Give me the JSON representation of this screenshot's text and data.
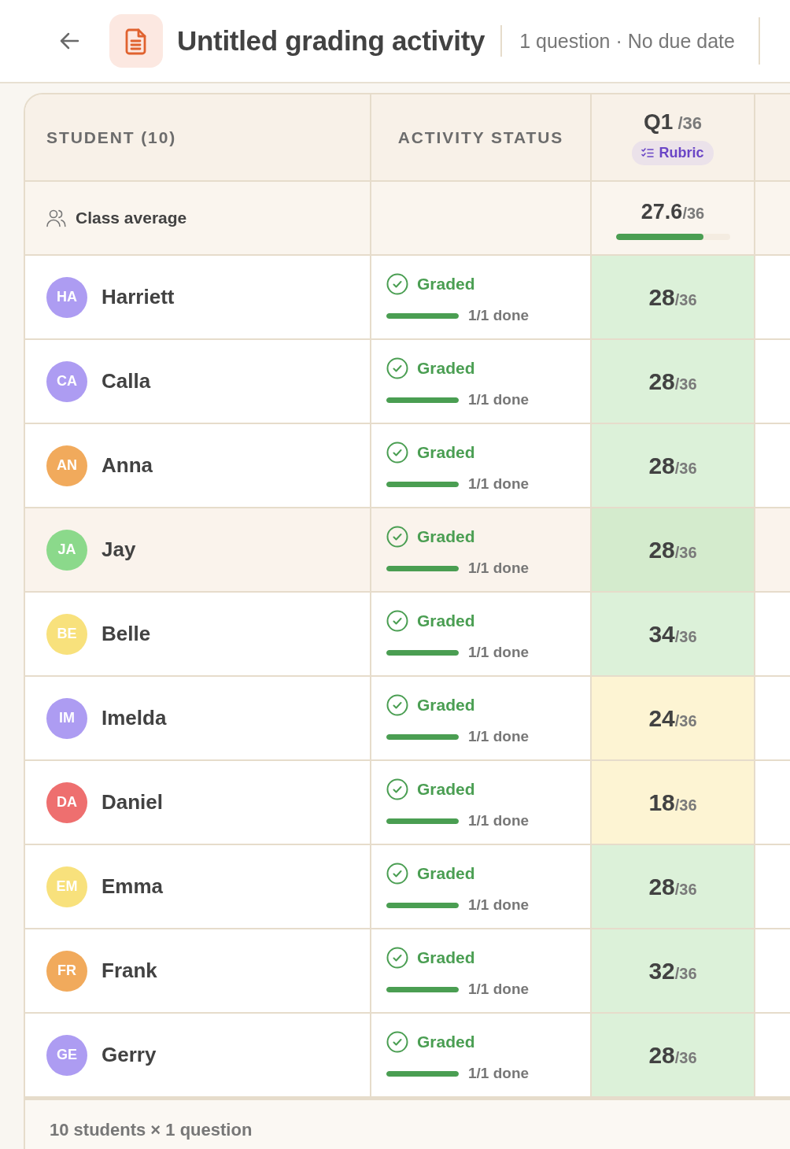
{
  "header": {
    "title": "Untitled grading activity",
    "subtitle": "1 question · No due date"
  },
  "table": {
    "columns": [
      {
        "kind": "text",
        "label": "STUDENT (10)"
      },
      {
        "kind": "text",
        "label": "ACTIVITY STATUS"
      },
      {
        "kind": "question",
        "label": "Q1",
        "max": "/36",
        "tag": "Rubric"
      }
    ],
    "class_average": {
      "label": "Class average",
      "score": "27.6",
      "max": "/36",
      "level": 0.767
    },
    "rows": [
      {
        "initials": "HA",
        "color": "#ad9cf2",
        "name": "Harriett",
        "selected": false,
        "status": "Graded",
        "progress": {
          "level": 1,
          "text": "1/1 done"
        },
        "score": {
          "value": "28",
          "max": "/36",
          "kind": "high"
        }
      },
      {
        "initials": "CA",
        "color": "#ad9cf2",
        "name": "Calla",
        "selected": false,
        "status": "Graded",
        "progress": {
          "level": 1,
          "text": "1/1 done"
        },
        "score": {
          "value": "28",
          "max": "/36",
          "kind": "high"
        }
      },
      {
        "initials": "AN",
        "color": "#f1aa5c",
        "name": "Anna",
        "selected": false,
        "status": "Graded",
        "progress": {
          "level": 1,
          "text": "1/1 done"
        },
        "score": {
          "value": "28",
          "max": "/36",
          "kind": "high"
        }
      },
      {
        "initials": "JA",
        "color": "#8bd98b",
        "name": "Jay",
        "selected": true,
        "status": "Graded",
        "progress": {
          "level": 1,
          "text": "1/1 done"
        },
        "score": {
          "value": "28",
          "max": "/36",
          "kind": "high"
        }
      },
      {
        "initials": "BE",
        "color": "#f8e17c",
        "name": "Belle",
        "selected": false,
        "status": "Graded",
        "progress": {
          "level": 1,
          "text": "1/1 done"
        },
        "score": {
          "value": "34",
          "max": "/36",
          "kind": "high"
        }
      },
      {
        "initials": "IM",
        "color": "#ad9cf2",
        "name": "Imelda",
        "selected": false,
        "status": "Graded",
        "progress": {
          "level": 1,
          "text": "1/1 done"
        },
        "score": {
          "value": "24",
          "max": "/36",
          "kind": "mid"
        }
      },
      {
        "initials": "DA",
        "color": "#ee6f6f",
        "name": "Daniel",
        "selected": false,
        "status": "Graded",
        "progress": {
          "level": 1,
          "text": "1/1 done"
        },
        "score": {
          "value": "18",
          "max": "/36",
          "kind": "mid"
        }
      },
      {
        "initials": "EM",
        "color": "#f8e17c",
        "name": "Emma",
        "selected": false,
        "status": "Graded",
        "progress": {
          "level": 1,
          "text": "1/1 done"
        },
        "score": {
          "value": "28",
          "max": "/36",
          "kind": "high"
        }
      },
      {
        "initials": "FR",
        "color": "#f1aa5c",
        "name": "Frank",
        "selected": false,
        "status": "Graded",
        "progress": {
          "level": 1,
          "text": "1/1 done"
        },
        "score": {
          "value": "32",
          "max": "/36",
          "kind": "high"
        }
      },
      {
        "initials": "GE",
        "color": "#ad9cf2",
        "name": "Gerry",
        "selected": false,
        "status": "Graded",
        "progress": {
          "level": 1,
          "text": "1/1 done"
        },
        "score": {
          "value": "28",
          "max": "/36",
          "kind": "high"
        }
      }
    ],
    "footer": "10 students × 1 question"
  }
}
